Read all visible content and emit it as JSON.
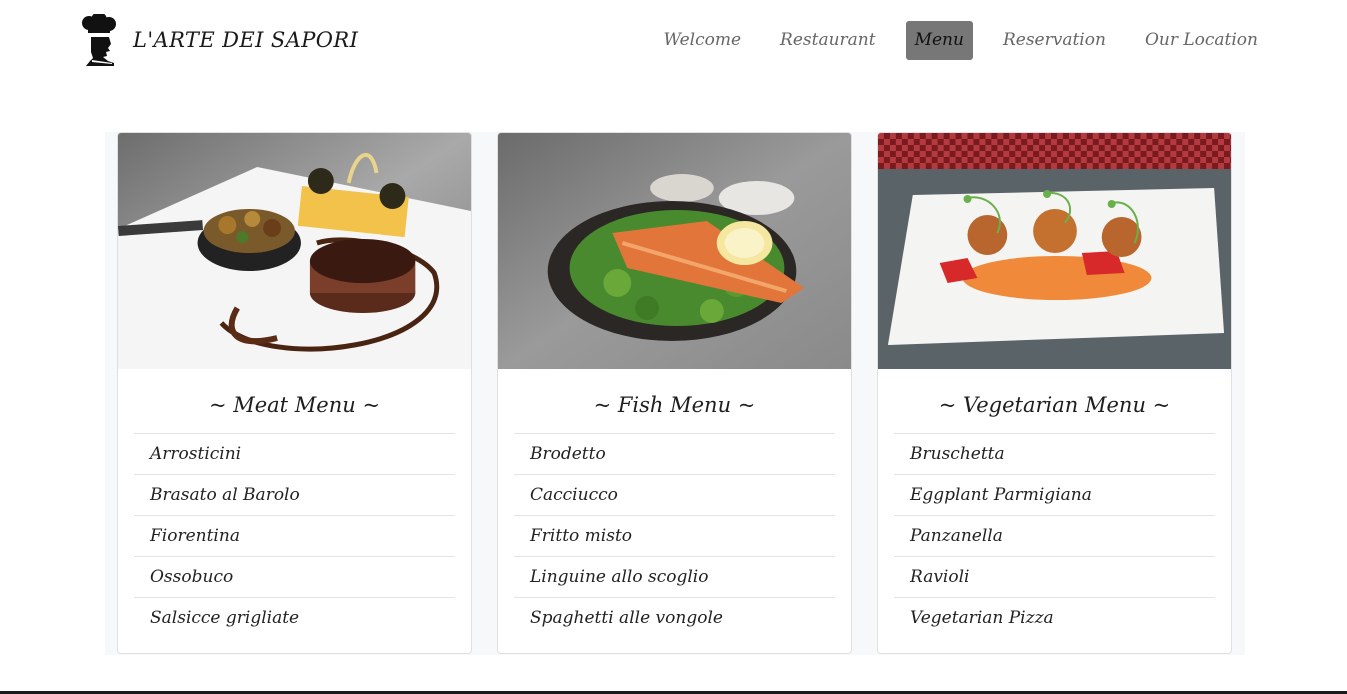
{
  "brand": {
    "name": "L'ARTE DEI SAPORI",
    "logo_icon": "chef-silhouette-icon"
  },
  "nav": {
    "items": [
      {
        "label": "Welcome"
      },
      {
        "label": "Restaurant"
      },
      {
        "label": "Menu",
        "active": true
      },
      {
        "label": "Reservation"
      },
      {
        "label": "Our Location"
      }
    ]
  },
  "cards": [
    {
      "title": "~ Meat Menu ~",
      "image": "steak-plate-photo",
      "items": [
        "Arrosticini",
        "Brasato al Barolo",
        "Fiorentina",
        "Ossobuco",
        "Salsicce grigliate"
      ]
    },
    {
      "title": "~ Fish Menu ~",
      "image": "salmon-salad-photo",
      "items": [
        "Brodetto",
        "Cacciucco",
        "Fritto misto",
        "Linguine allo scoglio",
        "Spaghetti alle vongole"
      ]
    },
    {
      "title": "~ Vegetarian Menu ~",
      "image": "vegetarian-croquettes-photo",
      "items": [
        "Bruschetta",
        "Eggplant Parmigiana",
        "Panzanella",
        "Ravioli",
        "Vegetarian Pizza"
      ]
    }
  ],
  "colors": {
    "nav_active_bg": "#777777",
    "page_bg": "#ffffff",
    "cards_bg": "#f7f8f9"
  }
}
